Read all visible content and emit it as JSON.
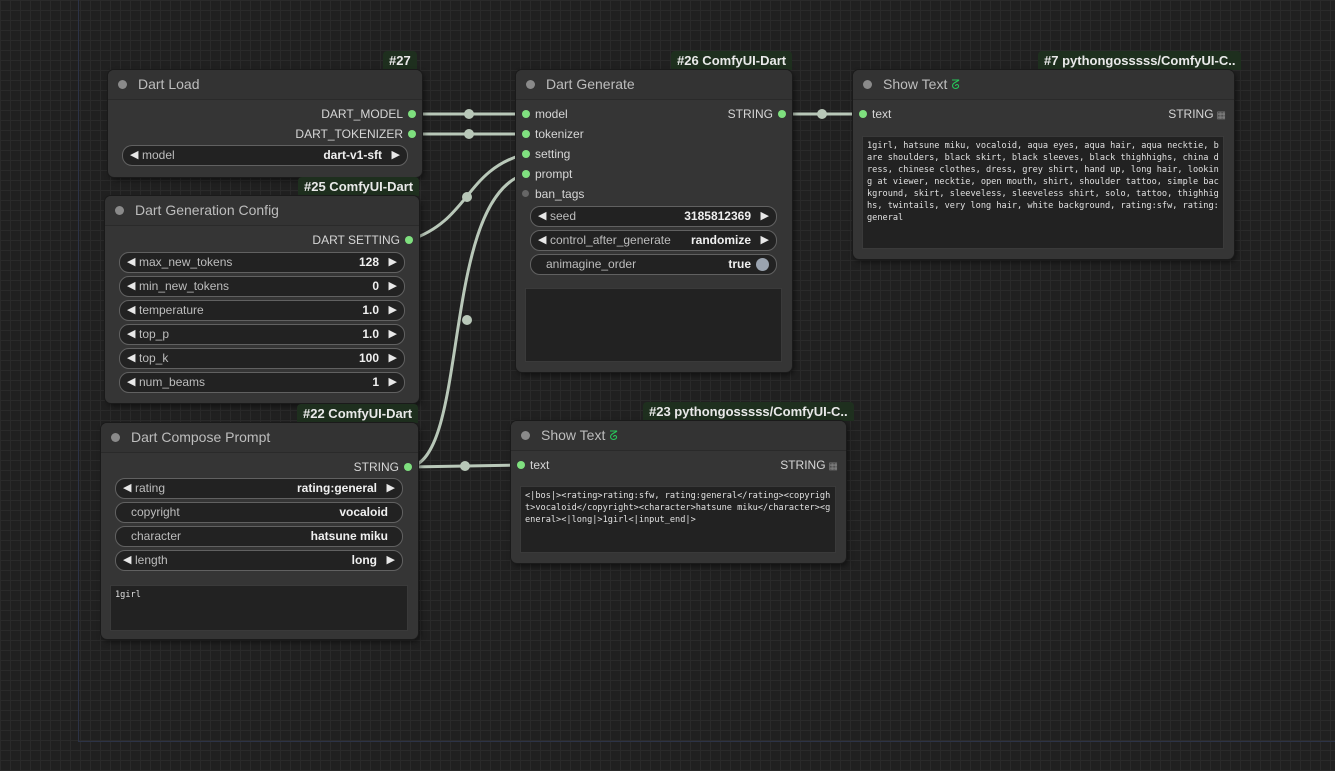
{
  "nodes": {
    "dart_load": {
      "badge": "#27",
      "title": "Dart Load",
      "outputs": [
        "DART_MODEL",
        "DART_TOKENIZER"
      ],
      "widgets": {
        "model_label": "model",
        "model_value": "dart-v1-sft"
      }
    },
    "dart_generate": {
      "badge": "#26 ComfyUI-Dart",
      "title": "Dart Generate",
      "inputs": [
        "model",
        "tokenizer",
        "setting",
        "prompt",
        "ban_tags"
      ],
      "output": "STRING",
      "widgets": {
        "seed_label": "seed",
        "seed_value": "3185812369",
        "control_label": "control_after_generate",
        "control_value": "randomize",
        "animagine_label": "animagine_order",
        "animagine_value": "true"
      }
    },
    "show_text_7": {
      "badge": "#7 pythongosssss/ComfyUI-C..",
      "title": "Show Text",
      "input": "text",
      "output": "STRING",
      "content": "1girl, hatsune miku, vocaloid, aqua eyes, aqua hair, aqua necktie, bare shoulders, black skirt, black sleeves, black thighhighs, china dress, chinese clothes, dress, grey shirt, hand up, long hair, looking at viewer, necktie, open mouth, shirt, shoulder tattoo, simple background, skirt, sleeveless, sleeveless shirt, solo, tattoo, thighhighs, twintails, very long hair, white background, rating:sfw, rating:general"
    },
    "dart_generation_config": {
      "badge": "#25 ComfyUI-Dart",
      "title": "Dart Generation Config",
      "output": "DART SETTING",
      "widgets": [
        {
          "label": "max_new_tokens",
          "value": "128"
        },
        {
          "label": "min_new_tokens",
          "value": "0"
        },
        {
          "label": "temperature",
          "value": "1.0"
        },
        {
          "label": "top_p",
          "value": "1.0"
        },
        {
          "label": "top_k",
          "value": "100"
        },
        {
          "label": "num_beams",
          "value": "1"
        }
      ]
    },
    "dart_compose_prompt": {
      "badge": "#22 ComfyUI-Dart",
      "title": "Dart Compose Prompt",
      "output": "STRING",
      "widgets": {
        "rating_label": "rating",
        "rating_value": "rating:general",
        "copyright_label": "copyright",
        "copyright_value": "vocaloid",
        "character_label": "character",
        "character_value": "hatsune miku",
        "length_label": "length",
        "length_value": "long"
      },
      "content": "1girl"
    },
    "show_text_23": {
      "badge": "#23 pythongosssss/ComfyUI-C..",
      "title": "Show Text",
      "input": "text",
      "output": "STRING",
      "content": "<|bos|><rating>rating:sfw, rating:general</rating><copyright>vocaloid</copyright><character>hatsune miku</character><general><|long|>1girl<|input_end|>"
    }
  },
  "icons": {
    "show_text_title": "python-snake-icon",
    "string_output": "grid-icon"
  },
  "colors": {
    "slot_active": "#7fe07f",
    "slot_inactive": "#666666",
    "badge_bg": "#1e2f1e",
    "wire": "#b9c8b9",
    "python_icon": "#27c45a"
  }
}
